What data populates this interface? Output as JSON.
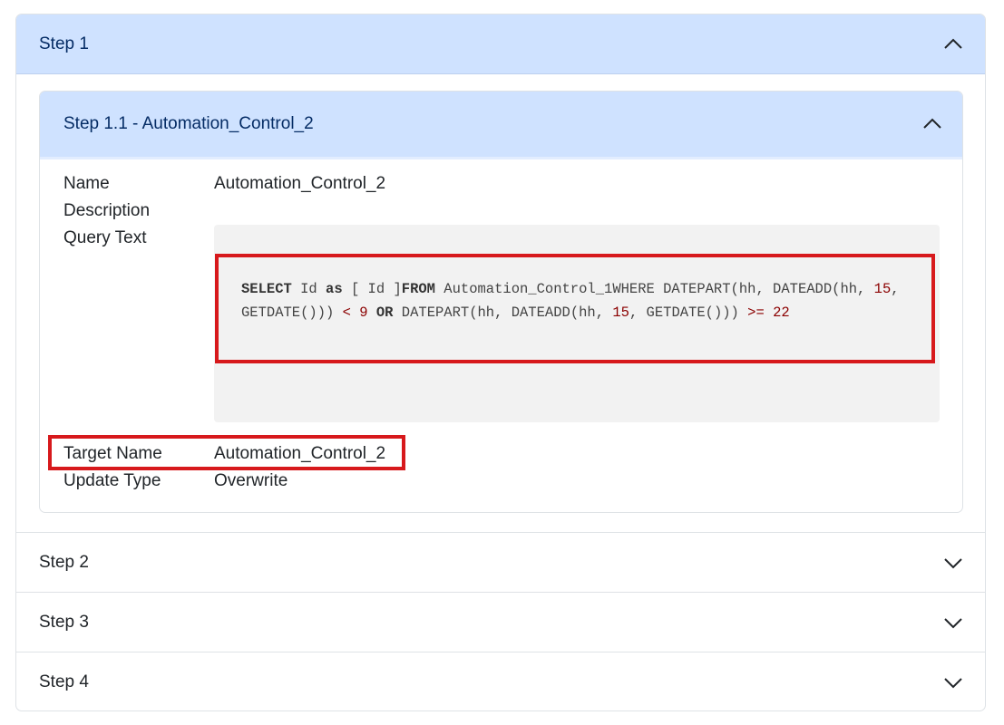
{
  "steps": [
    {
      "label": "Step 1",
      "expanded": true
    },
    {
      "label": "Step 2",
      "expanded": false
    },
    {
      "label": "Step 3",
      "expanded": false
    },
    {
      "label": "Step 4",
      "expanded": false
    }
  ],
  "substep": {
    "title": "Step 1.1 - Automation_Control_2",
    "fields": {
      "name_label": "Name",
      "name_value": "Automation_Control_2",
      "description_label": "Description",
      "description_value": "",
      "query_label": "Query Text",
      "target_label": "Target Name",
      "target_value": "Automation_Control_2",
      "update_label": "Update Type",
      "update_value": "Overwrite"
    },
    "query_tokens": [
      {
        "text": "SELECT",
        "class": "kw"
      },
      {
        "text": "  Id ",
        "class": ""
      },
      {
        "text": "as",
        "class": "kw"
      },
      {
        "text": " [ Id ]",
        "class": ""
      },
      {
        "text": "FROM",
        "class": "kw"
      },
      {
        "text": "  Automation_Control_1WHERE  DATEPART(hh, DATEADD(hh, ",
        "class": ""
      },
      {
        "text": "15",
        "class": "num"
      },
      {
        "text": ", GETDATE())) ",
        "class": ""
      },
      {
        "text": "<",
        "class": "op"
      },
      {
        "text": " ",
        "class": ""
      },
      {
        "text": "9",
        "class": "num"
      },
      {
        "text": "  ",
        "class": ""
      },
      {
        "text": "OR",
        "class": "kw"
      },
      {
        "text": " DATEPART(hh, DATEADD(hh, ",
        "class": ""
      },
      {
        "text": "15",
        "class": "num"
      },
      {
        "text": ", GETDATE())) ",
        "class": ""
      },
      {
        "text": ">=",
        "class": "op"
      },
      {
        "text": " ",
        "class": ""
      },
      {
        "text": "22",
        "class": "num"
      }
    ]
  },
  "icons": {
    "expanded": "chevron-up-icon",
    "collapsed": "chevron-down-icon"
  },
  "colors": {
    "header_active_bg": "#cfe2ff",
    "highlight_border": "#d7191c"
  }
}
